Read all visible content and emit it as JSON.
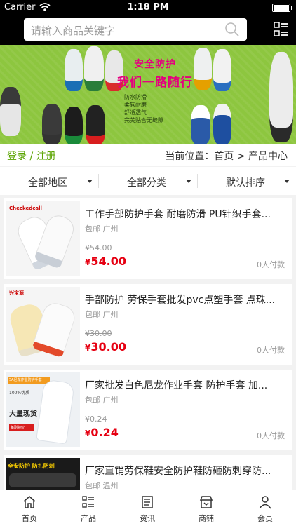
{
  "status": {
    "carrier": "Carrier",
    "time": "1:18 PM"
  },
  "search": {
    "placeholder": "请输入商品关键字"
  },
  "banner": {
    "title1": "安全防护",
    "title2": "我们一路随行",
    "features": [
      "防水防滑",
      "柔软耐磨",
      "舒适透气",
      "完美贴合无缝隙"
    ]
  },
  "location": {
    "login": "登录 / 注册",
    "path": "当前位置：首页 > 产品中心"
  },
  "filters": [
    "全部地区",
    "全部分类",
    "默认排序"
  ],
  "products": [
    {
      "name": "工作手部防护手套 耐磨防滑 PU针织手套...",
      "shipping": "包邮 广州",
      "old_price": "¥54.00",
      "price_currency": "¥",
      "price": "54.00",
      "sold": "0人付款",
      "brand": "Checkedcall"
    },
    {
      "name": "手部防护 劳保手套批发pvc点塑手套 点珠...",
      "shipping": "包邮 广州",
      "old_price": "¥30.00",
      "price_currency": "¥",
      "price": "30.00",
      "sold": "0人付款",
      "brand": "兴宝源"
    },
    {
      "name": "厂家批发白色尼龙作业手套 防护手套 加...",
      "shipping": "包邮 广州",
      "old_price": "¥0.24",
      "price_currency": "¥",
      "price": "0.24",
      "sold": "0人付款",
      "promo1": "5A尼龙作业防护手套",
      "promo2": "100%优质",
      "promo3": "大量现货",
      "promo4": "每副特价"
    },
    {
      "name": "厂家直销劳保鞋安全防护鞋防砸防刺穿防...",
      "shipping": "包邮 温州",
      "old_price": "",
      "price_currency": "",
      "price": "",
      "sold": "",
      "promo1": "全安防护 防扎防刺"
    }
  ],
  "tabs": [
    "首页",
    "产品",
    "资讯",
    "商铺",
    "会员"
  ]
}
